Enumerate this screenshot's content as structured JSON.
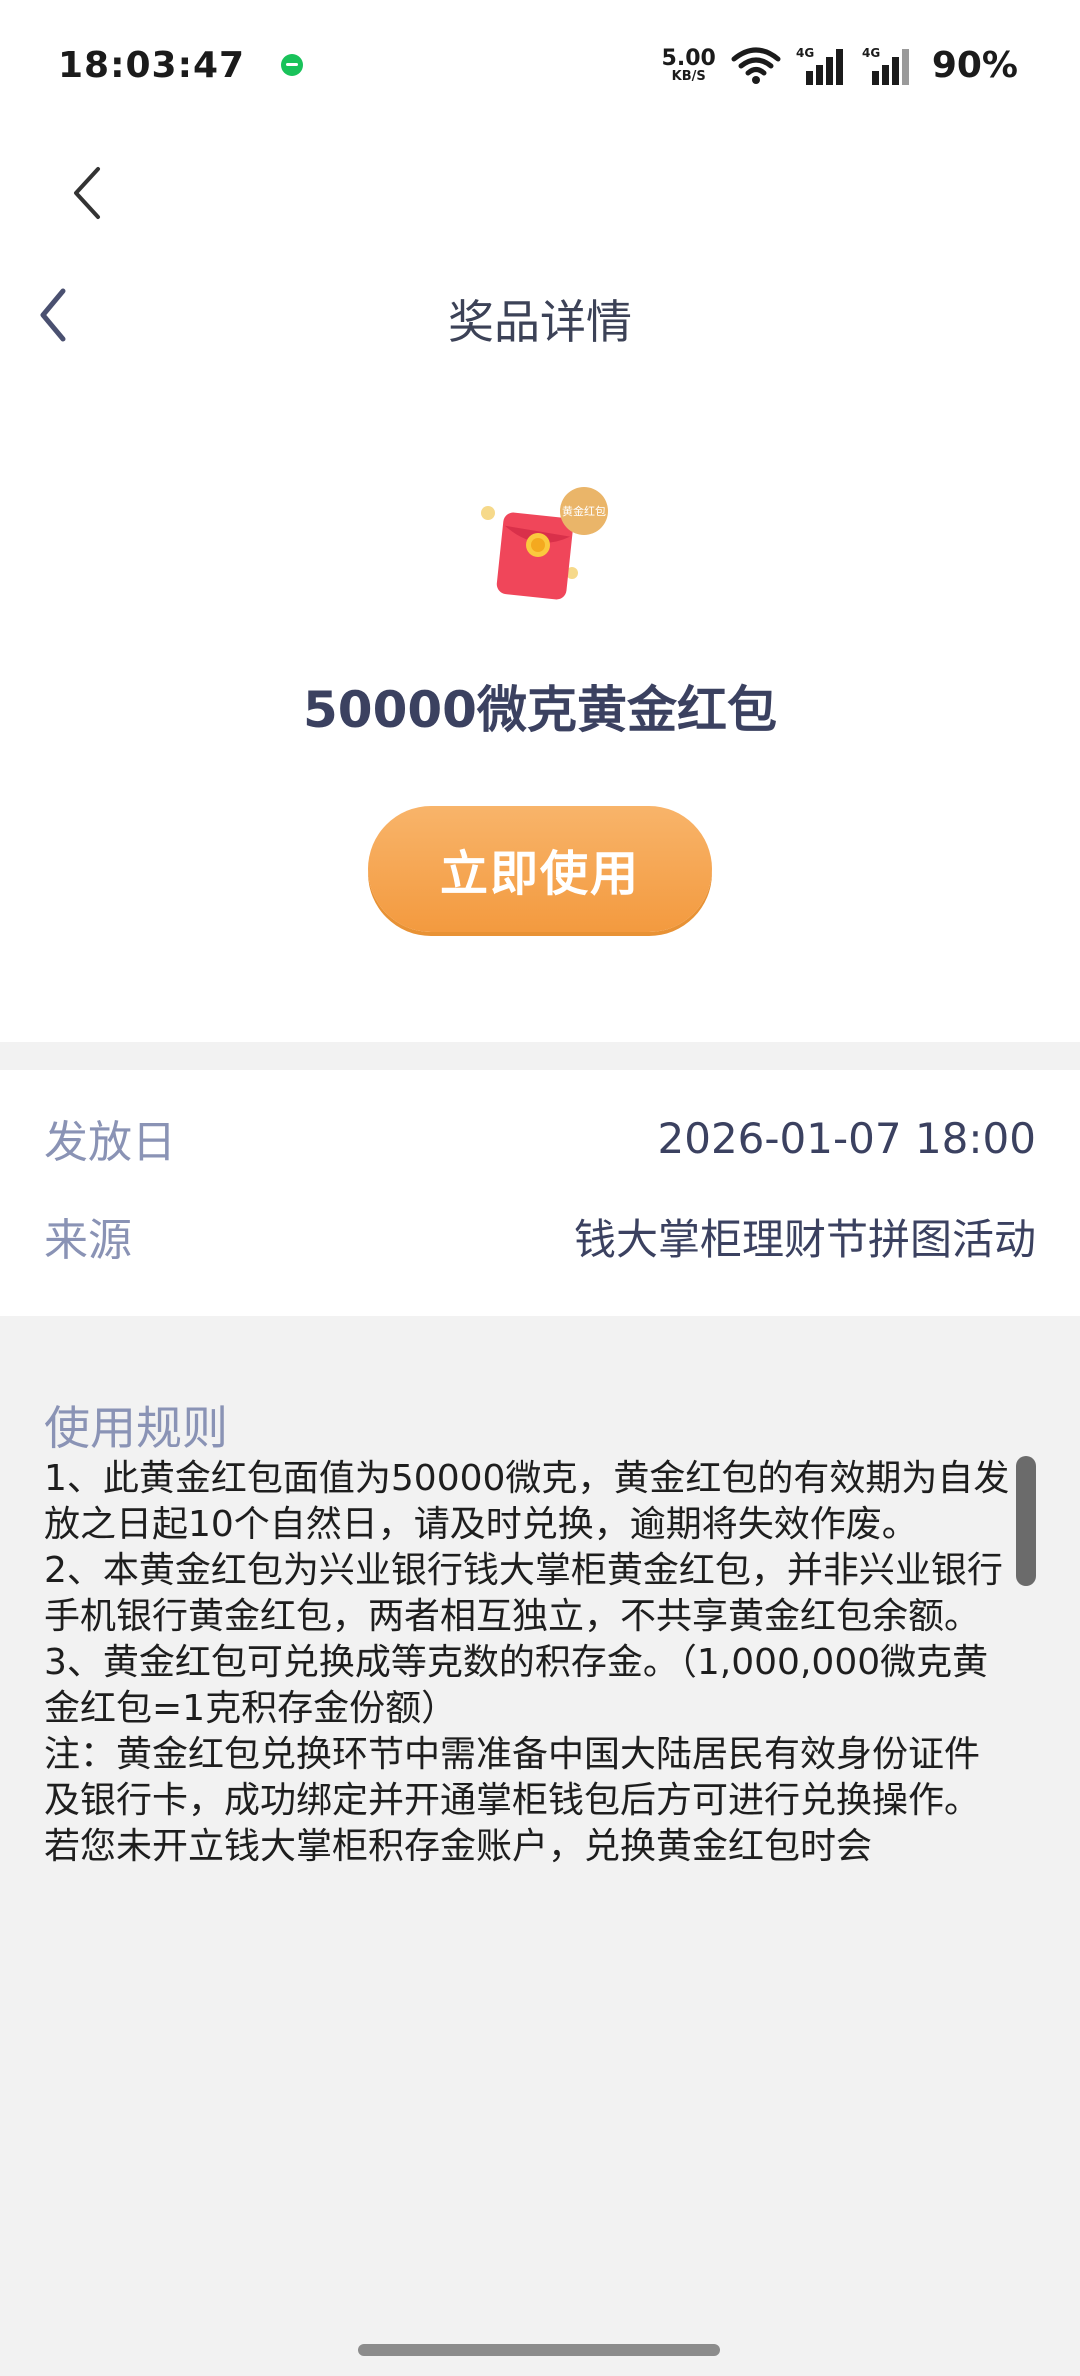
{
  "status_bar": {
    "time": "18:03:47",
    "net_speed_value": "5.00",
    "net_speed_unit": "KB/S",
    "battery": "90%",
    "signal_label_1": "4G",
    "signal_label_2": "4G",
    "wifi_label": "6"
  },
  "header": {
    "title": "奖品详情"
  },
  "prize": {
    "badge_text": "黄金红包",
    "title": "50000微克黄金红包",
    "use_button_label": "立即使用"
  },
  "info": {
    "issue_date_label": "发放日",
    "issue_date_value": "2026-01-07 18:00",
    "source_label": "来源",
    "source_value": "钱大掌柜理财节拼图活动"
  },
  "rules": {
    "title": "使用规则",
    "text": "1、此黄金红包面值为50000微克，黄金红包的有效期为自发放之日起10个自然日，请及时兑换，逾期将失效作废。\n2、本黄金红包为兴业银行钱大掌柜黄金红包，并非兴业银行手机银行黄金红包，两者相互独立，不共享黄金红包余额。\n3、黄金红包可兑换成等克数的积存金。（1,000,000微克黄金红包=1克积存金份额）\n注：黄金红包兑换环节中需准备中国大陆居民有效身份证件及银行卡，成功绑定并开通掌柜钱包后方可进行兑换操作。若您未开立钱大掌柜积存金账户，兑换黄金红包时会"
  },
  "colors": {
    "button_gradient_top": "#f8b46a",
    "button_gradient_bottom": "#f39a3f",
    "label_color": "#8a93b5",
    "value_color": "#3b4160",
    "page_bg": "#f2f2f2"
  }
}
